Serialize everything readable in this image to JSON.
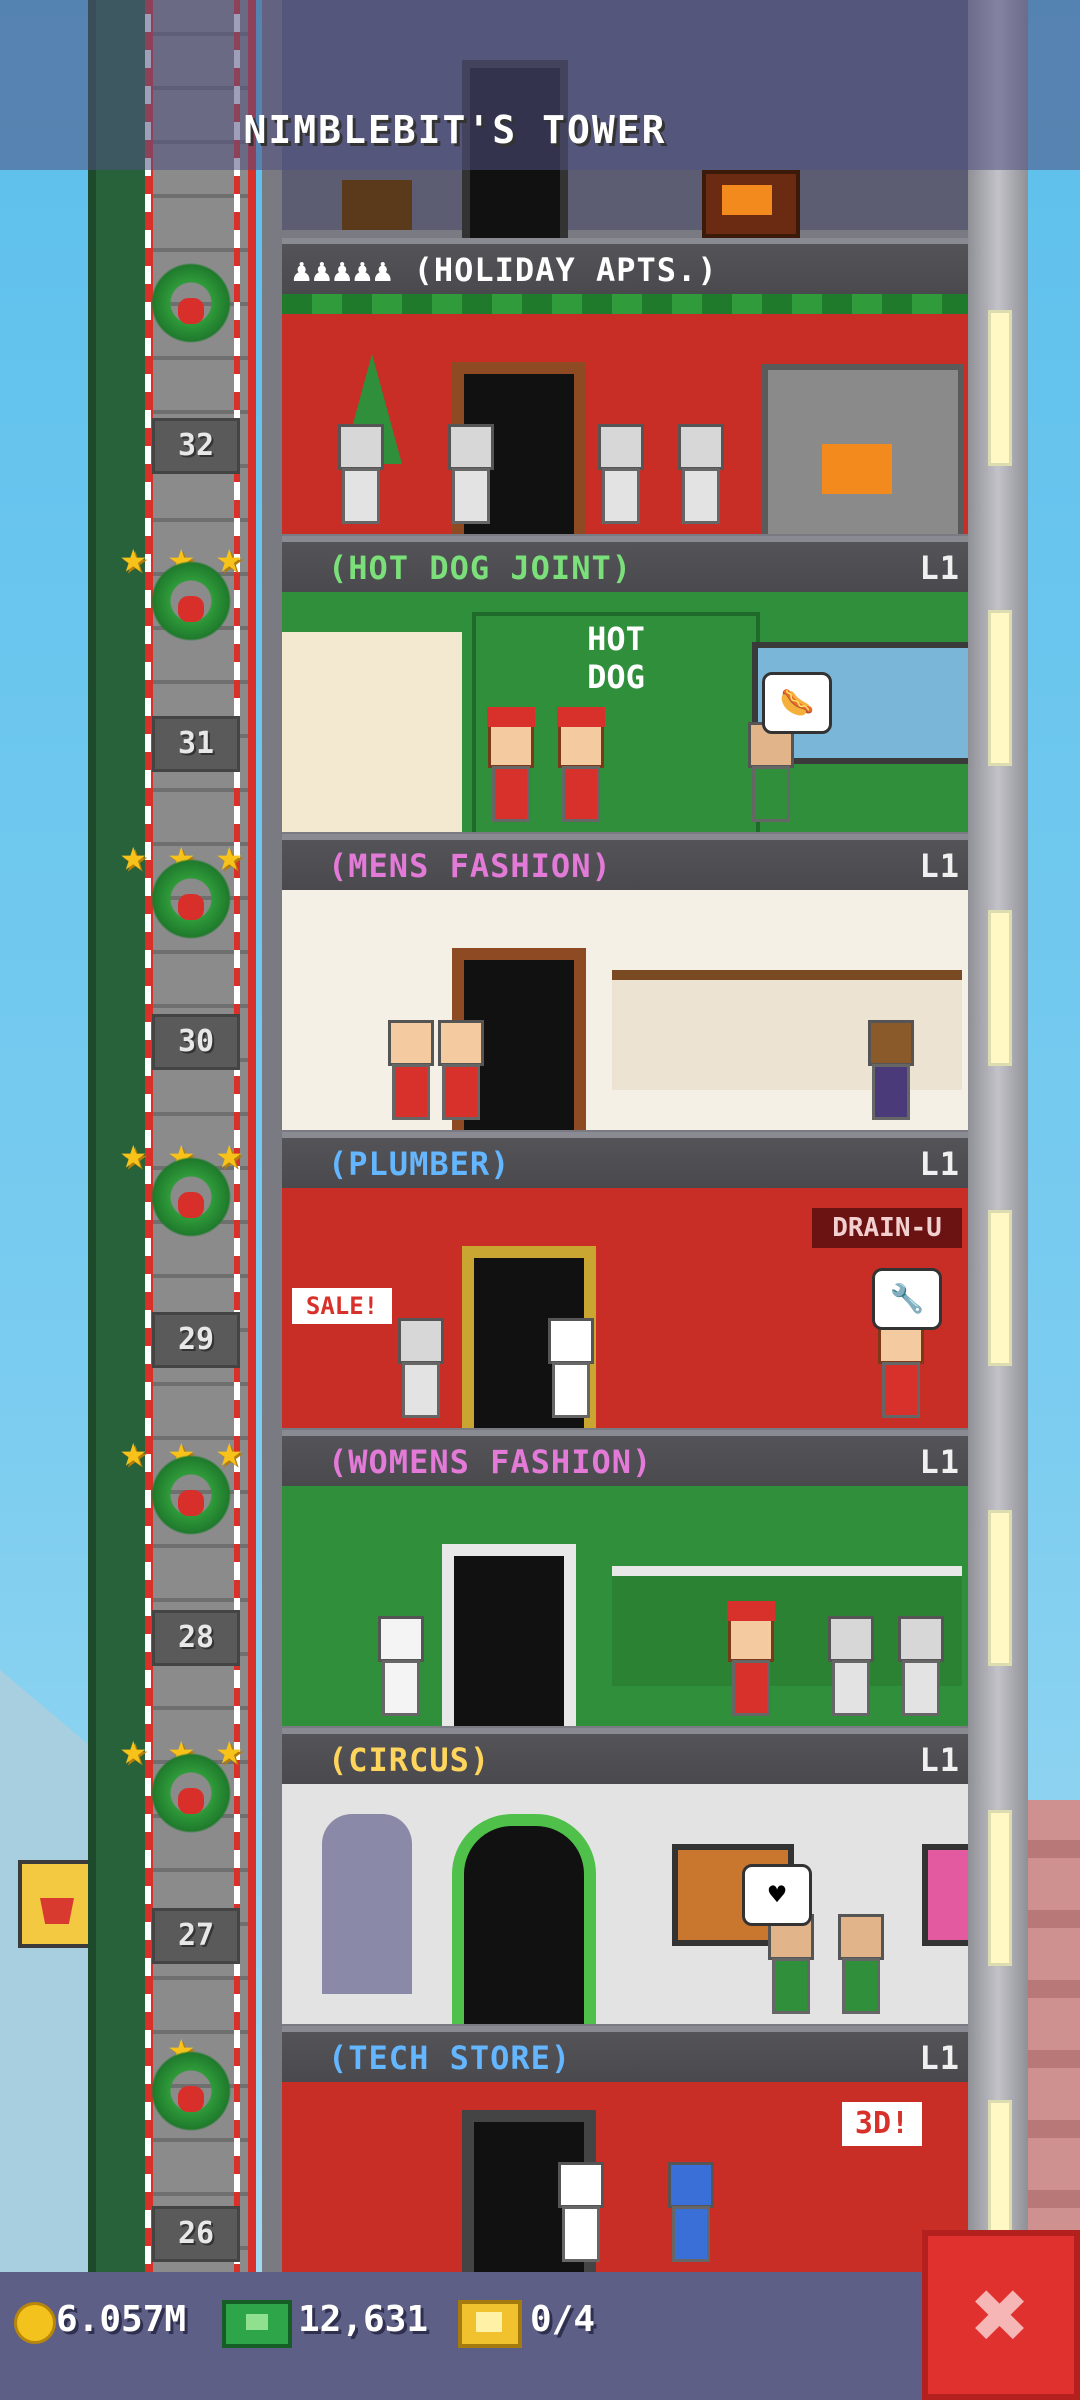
{
  "header": {
    "title": "NIMBLEBIT'S TOWER"
  },
  "floors": [
    {
      "number": "32",
      "name": "♟♟♟♟♟ (HOLIDAY APTS.)",
      "level": "",
      "name_color": "#ffffff",
      "bg": "#c92e26"
    },
    {
      "number": "31",
      "name": "(HOT DOG JOINT)",
      "level": "L1",
      "name_color": "#7be07a",
      "bg": "#2f8f3a"
    },
    {
      "number": "30",
      "name": "(MENS FASHION)",
      "level": "L1",
      "name_color": "#e37ad8",
      "bg": "#f4f0e6"
    },
    {
      "number": "29",
      "name": "(PLUMBER)",
      "level": "L1",
      "name_color": "#63b6ff",
      "bg": "#c92e26"
    },
    {
      "number": "28",
      "name": "(WOMENS FASHION)",
      "level": "L1",
      "name_color": "#e37ad8",
      "bg": "#2f8f3a"
    },
    {
      "number": "27",
      "name": "(CIRCUS)",
      "level": "L1",
      "name_color": "#ffd55c",
      "bg": "#e3e3e3"
    },
    {
      "number": "26",
      "name": "(TECH STORE)",
      "level": "L1",
      "name_color": "#63b6ff",
      "bg": "#c92e26"
    }
  ],
  "signs": {
    "hotdog": "HOT\nDOG",
    "plumber": "DRAIN-U",
    "sale": "SALE!",
    "tech": "3D!"
  },
  "status_bar": {
    "coins": "6.057M",
    "cash": "12,631",
    "bux": "0/4"
  },
  "buttons": {
    "close": "✖"
  },
  "colors": {
    "accent_red": "#e0312e",
    "bar": "#5d5f86",
    "shaft_green": "#27623a"
  }
}
